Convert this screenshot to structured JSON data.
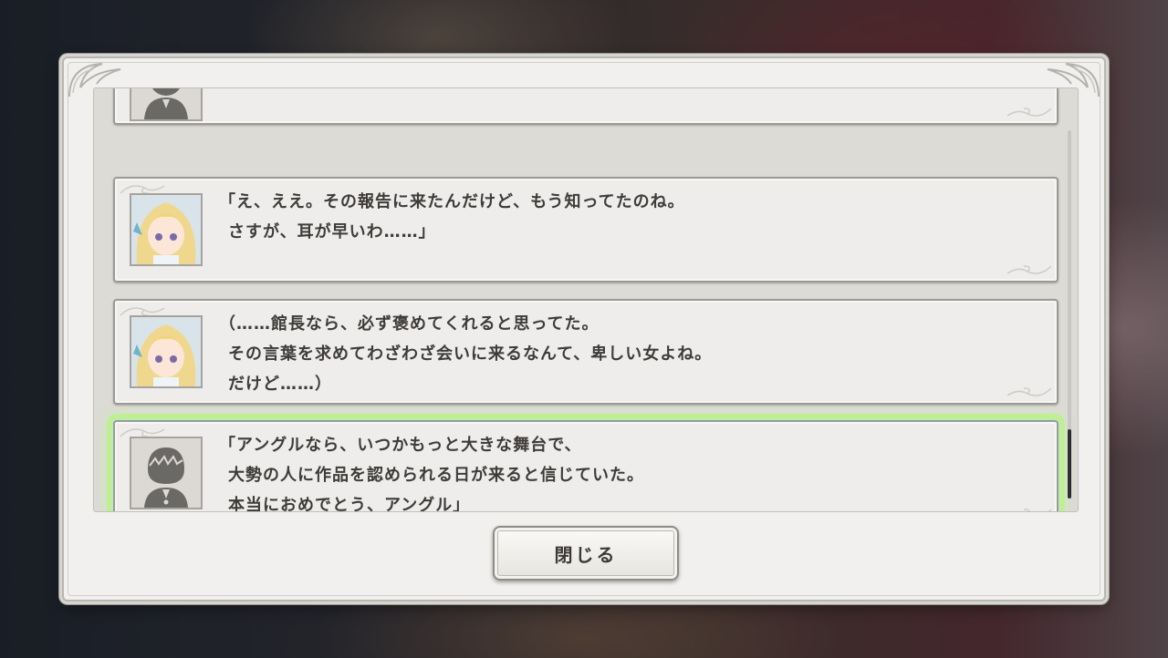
{
  "backlog": {
    "entries": [
      {
        "speaker_icon": "protagonist-silhouette-icon",
        "lines": [
          "…………………………"
        ]
      },
      {
        "speaker_icon": "blonde-girl-portrait",
        "lines": [
          "「え、ええ。その報告に来たんだけど、もう知ってたのね。",
          "さすが、耳が早いわ……」"
        ]
      },
      {
        "speaker_icon": "blonde-girl-portrait",
        "lines": [
          "（……館長なら、必ず褒めてくれると思ってた。",
          "その言葉を求めてわざわざ会いに来るなんて、卑しい女よね。",
          "だけど……）"
        ]
      },
      {
        "speaker_icon": "protagonist-silhouette-icon",
        "lines": [
          "「アングルなら、いつかもっと大きな舞台で、",
          "大勢の人に作品を認められる日が来ると信じていた。",
          "本当におめでとう、アングル」"
        ]
      }
    ]
  },
  "buttons": {
    "close_label": "閉じる"
  },
  "colors": {
    "panel": "#f1f0ee",
    "entry_border": "#9c9a95",
    "text": "#3e3b38",
    "highlight": "#c8f078"
  }
}
